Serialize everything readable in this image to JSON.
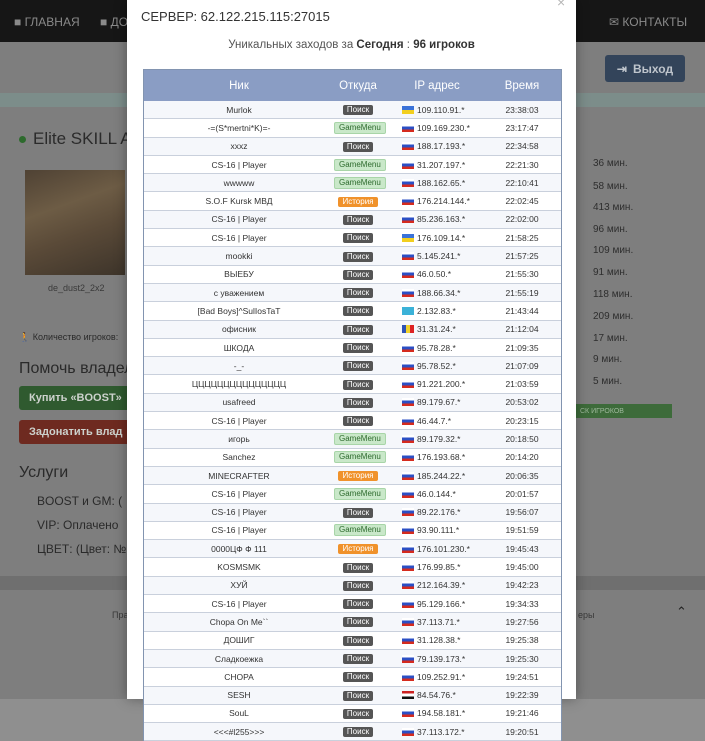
{
  "nav": {
    "items": [
      "ГЛАВНАЯ",
      "ДО",
      "КОНТАКТЫ"
    ]
  },
  "header": {
    "logout_label": "Выход"
  },
  "server_page": {
    "name": "Elite SKILL AR",
    "map": "de_dust2_2x2",
    "players_label": "Количество игроков:",
    "help_title": "Помочь владел",
    "buy_boost": "Купить «BOOST»",
    "donate": "Задонатить влад",
    "services_title": "Услуги",
    "services": [
      "BOOST и GM:   (",
      "VIP:   Оплачено",
      "ЦВЕТ:   (Цвет: №"
    ],
    "durations": [
      "36 мин.",
      "58 мин.",
      "413 мин.",
      "96 мин.",
      "109 мин.",
      "91 мин.",
      "118 мин.",
      "209 мин.",
      "17 мин.",
      "9 мин.",
      "5 мин."
    ],
    "green_bar": "СК ИГРОКОВ",
    "footer_left": "Пра",
    "footer_right": "еры"
  },
  "modal": {
    "title": "СЕРВЕР: 62.122.215.115:27015",
    "subtitle_prefix": "Уникальных заходов за ",
    "subtitle_day": "Сегодня",
    "subtitle_sep": " : ",
    "subtitle_count": "96 игроков",
    "columns": {
      "nick": "Ник",
      "from": "Откуда",
      "ip": "IP адрес",
      "time": "Время"
    },
    "rows": [
      {
        "nick": "Murlok",
        "from": "Поиск",
        "src": "poisk",
        "flag": "ua",
        "ip": "109.110.91.*",
        "time": "23:38:03"
      },
      {
        "nick": "-=(S*mertni*K)=-",
        "from": "GameMenu",
        "src": "gm",
        "flag": "ru",
        "ip": "109.169.230.*",
        "time": "23:17:47"
      },
      {
        "nick": "xxxz",
        "from": "Поиск",
        "src": "poisk",
        "flag": "ru",
        "ip": "188.17.193.*",
        "time": "22:34:58"
      },
      {
        "nick": "CS-16 | Player",
        "from": "GameMenu",
        "src": "gm",
        "flag": "ru",
        "ip": "31.207.197.*",
        "time": "22:21:30"
      },
      {
        "nick": "wwwww",
        "from": "GameMenu",
        "src": "gm",
        "flag": "ru",
        "ip": "188.162.65.*",
        "time": "22:10:41"
      },
      {
        "nick": "S.O.F Kursk МВД",
        "from": "История",
        "src": "hist",
        "flag": "ru",
        "ip": "176.214.144.*",
        "time": "22:02:45"
      },
      {
        "nick": "CS-16 | Player",
        "from": "Поиск",
        "src": "poisk",
        "flag": "ru",
        "ip": "85.236.163.*",
        "time": "22:02:00"
      },
      {
        "nick": "CS-16 | Player",
        "from": "Поиск",
        "src": "poisk",
        "flag": "ua",
        "ip": "176.109.14.*",
        "time": "21:58:25"
      },
      {
        "nick": "mookki",
        "from": "Поиск",
        "src": "poisk",
        "flag": "ru",
        "ip": "5.145.241.*",
        "time": "21:57:25"
      },
      {
        "nick": "ВЫЕБУ",
        "from": "Поиск",
        "src": "poisk",
        "flag": "ru",
        "ip": "46.0.50.*",
        "time": "21:55:30"
      },
      {
        "nick": "с уважением",
        "from": "Поиск",
        "src": "poisk",
        "flag": "ru",
        "ip": "188.66.34.*",
        "time": "21:55:19"
      },
      {
        "nick": "[Bad Boys]^SulIosTaT",
        "from": "Поиск",
        "src": "poisk",
        "flag": "kz",
        "ip": "2.132.83.*",
        "time": "21:43:44"
      },
      {
        "nick": "офисник",
        "from": "Поиск",
        "src": "poisk",
        "flag": "md",
        "ip": "31.31.24.*",
        "time": "21:12:04"
      },
      {
        "nick": "ШКОДА",
        "from": "Поиск",
        "src": "poisk",
        "flag": "ru",
        "ip": "95.78.28.*",
        "time": "21:09:35"
      },
      {
        "nick": "-_-",
        "from": "Поиск",
        "src": "poisk",
        "flag": "ru",
        "ip": "95.78.52.*",
        "time": "21:07:09"
      },
      {
        "nick": "ЦЦЦЦЦЦЦЦЦЦЦЦЦЦЦ",
        "from": "Поиск",
        "src": "poisk",
        "flag": "ru",
        "ip": "91.221.200.*",
        "time": "21:03:59"
      },
      {
        "nick": "usafreed",
        "from": "Поиск",
        "src": "poisk",
        "flag": "ru",
        "ip": "89.179.67.*",
        "time": "20:53:02"
      },
      {
        "nick": "CS-16 | Player",
        "from": "Поиск",
        "src": "poisk",
        "flag": "ru",
        "ip": "46.44.7.*",
        "time": "20:23:15"
      },
      {
        "nick": "игорь",
        "from": "GameMenu",
        "src": "gm",
        "flag": "ru",
        "ip": "89.179.32.*",
        "time": "20:18:50"
      },
      {
        "nick": "Sanchez",
        "from": "GameMenu",
        "src": "gm",
        "flag": "ru",
        "ip": "176.193.68.*",
        "time": "20:14:20"
      },
      {
        "nick": "MINECRAFTER",
        "from": "История",
        "src": "hist",
        "flag": "ru",
        "ip": "185.244.22.*",
        "time": "20:06:35"
      },
      {
        "nick": "CS-16 | Player",
        "from": "GameMenu",
        "src": "gm",
        "flag": "ru",
        "ip": "46.0.144.*",
        "time": "20:01:57"
      },
      {
        "nick": "CS-16 | Player",
        "from": "Поиск",
        "src": "poisk",
        "flag": "ru",
        "ip": "89.22.176.*",
        "time": "19:56:07"
      },
      {
        "nick": "CS-16 | Player",
        "from": "GameMenu",
        "src": "gm",
        "flag": "ru",
        "ip": "93.90.111.*",
        "time": "19:51:59"
      },
      {
        "nick": "0000ЦФ Ф 111",
        "from": "История",
        "src": "hist",
        "flag": "ru",
        "ip": "176.101.230.*",
        "time": "19:45:43"
      },
      {
        "nick": "KOSMSMK",
        "from": "Поиск",
        "src": "poisk",
        "flag": "ru",
        "ip": "176.99.85.*",
        "time": "19:45:00"
      },
      {
        "nick": "ХУЙ",
        "from": "Поиск",
        "src": "poisk",
        "flag": "ru",
        "ip": "212.164.39.*",
        "time": "19:42:23"
      },
      {
        "nick": "CS-16 | Player",
        "from": "Поиск",
        "src": "poisk",
        "flag": "ru",
        "ip": "95.129.166.*",
        "time": "19:34:33"
      },
      {
        "nick": "Chopa On Me``",
        "from": "Поиск",
        "src": "poisk",
        "flag": "ru",
        "ip": "37.113.71.*",
        "time": "19:27:56"
      },
      {
        "nick": "ДОШИГ",
        "from": "Поиск",
        "src": "poisk",
        "flag": "ru",
        "ip": "31.128.38.*",
        "time": "19:25:38"
      },
      {
        "nick": "Сладкоежка",
        "from": "Поиск",
        "src": "poisk",
        "flag": "ru",
        "ip": "79.139.173.*",
        "time": "19:25:30"
      },
      {
        "nick": "CHOPA",
        "from": "Поиск",
        "src": "poisk",
        "flag": "ru",
        "ip": "109.252.91.*",
        "time": "19:24:51"
      },
      {
        "nick": "SESH",
        "from": "Поиск",
        "src": "poisk",
        "flag": "eg",
        "ip": "84.54.76.*",
        "time": "19:22:39"
      },
      {
        "nick": "SouL",
        "from": "Поиск",
        "src": "poisk",
        "flag": "ru",
        "ip": "194.58.181.*",
        "time": "19:21:46"
      },
      {
        "nick": "<<<#l255>>>",
        "from": "Поиск",
        "src": "poisk",
        "flag": "ru",
        "ip": "37.113.172.*",
        "time": "19:20:51"
      }
    ]
  }
}
